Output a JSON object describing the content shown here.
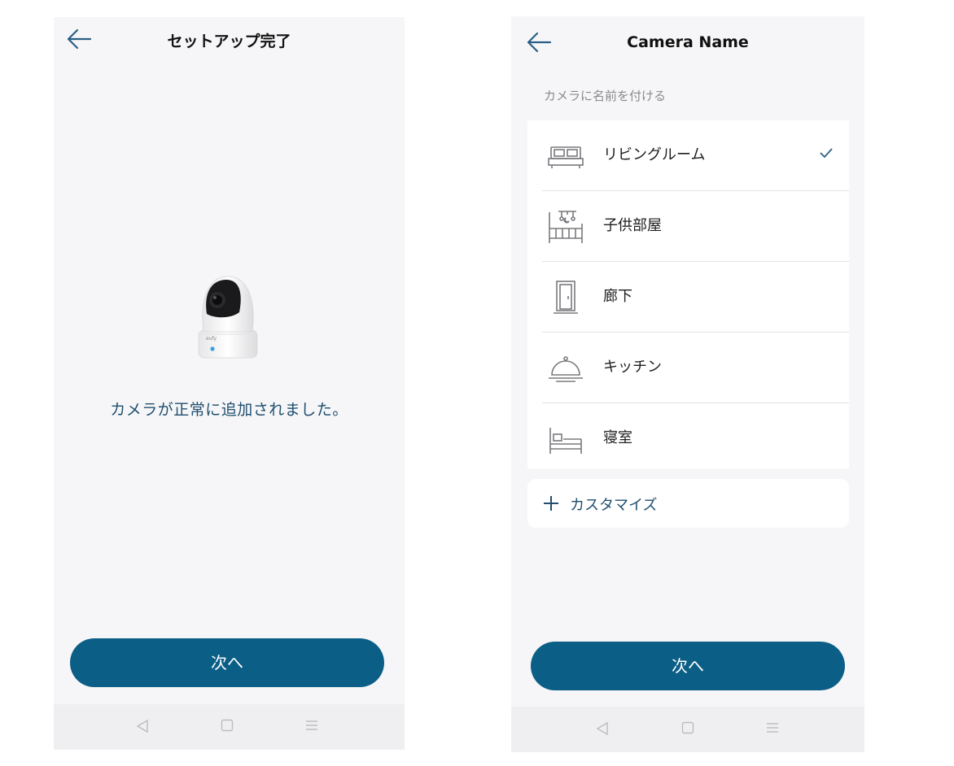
{
  "left_screen": {
    "title": "セットアップ完了",
    "message": "カメラが正常に追加されました。",
    "camera_brand": "eufy",
    "next_label": "次へ"
  },
  "right_screen": {
    "title": "Camera Name",
    "section_hint": "カメラに名前を付ける",
    "rooms": [
      {
        "label": "リビングルーム",
        "icon": "sofa-icon",
        "selected": true
      },
      {
        "label": "子供部屋",
        "icon": "crib-icon",
        "selected": false
      },
      {
        "label": "廊下",
        "icon": "door-icon",
        "selected": false
      },
      {
        "label": "キッチン",
        "icon": "cloche-icon",
        "selected": false
      },
      {
        "label": "寝室",
        "icon": "bed-icon",
        "selected": false
      }
    ],
    "customize_label": "カスタマイズ",
    "next_label": "次へ"
  },
  "nav_icons": [
    "back-triangle-icon",
    "home-square-icon",
    "menu-lines-icon"
  ],
  "colors": {
    "accent": "#0b5f86",
    "accent_text": "#1f4f6e",
    "background": "#f6f6f8",
    "card": "#ffffff"
  }
}
